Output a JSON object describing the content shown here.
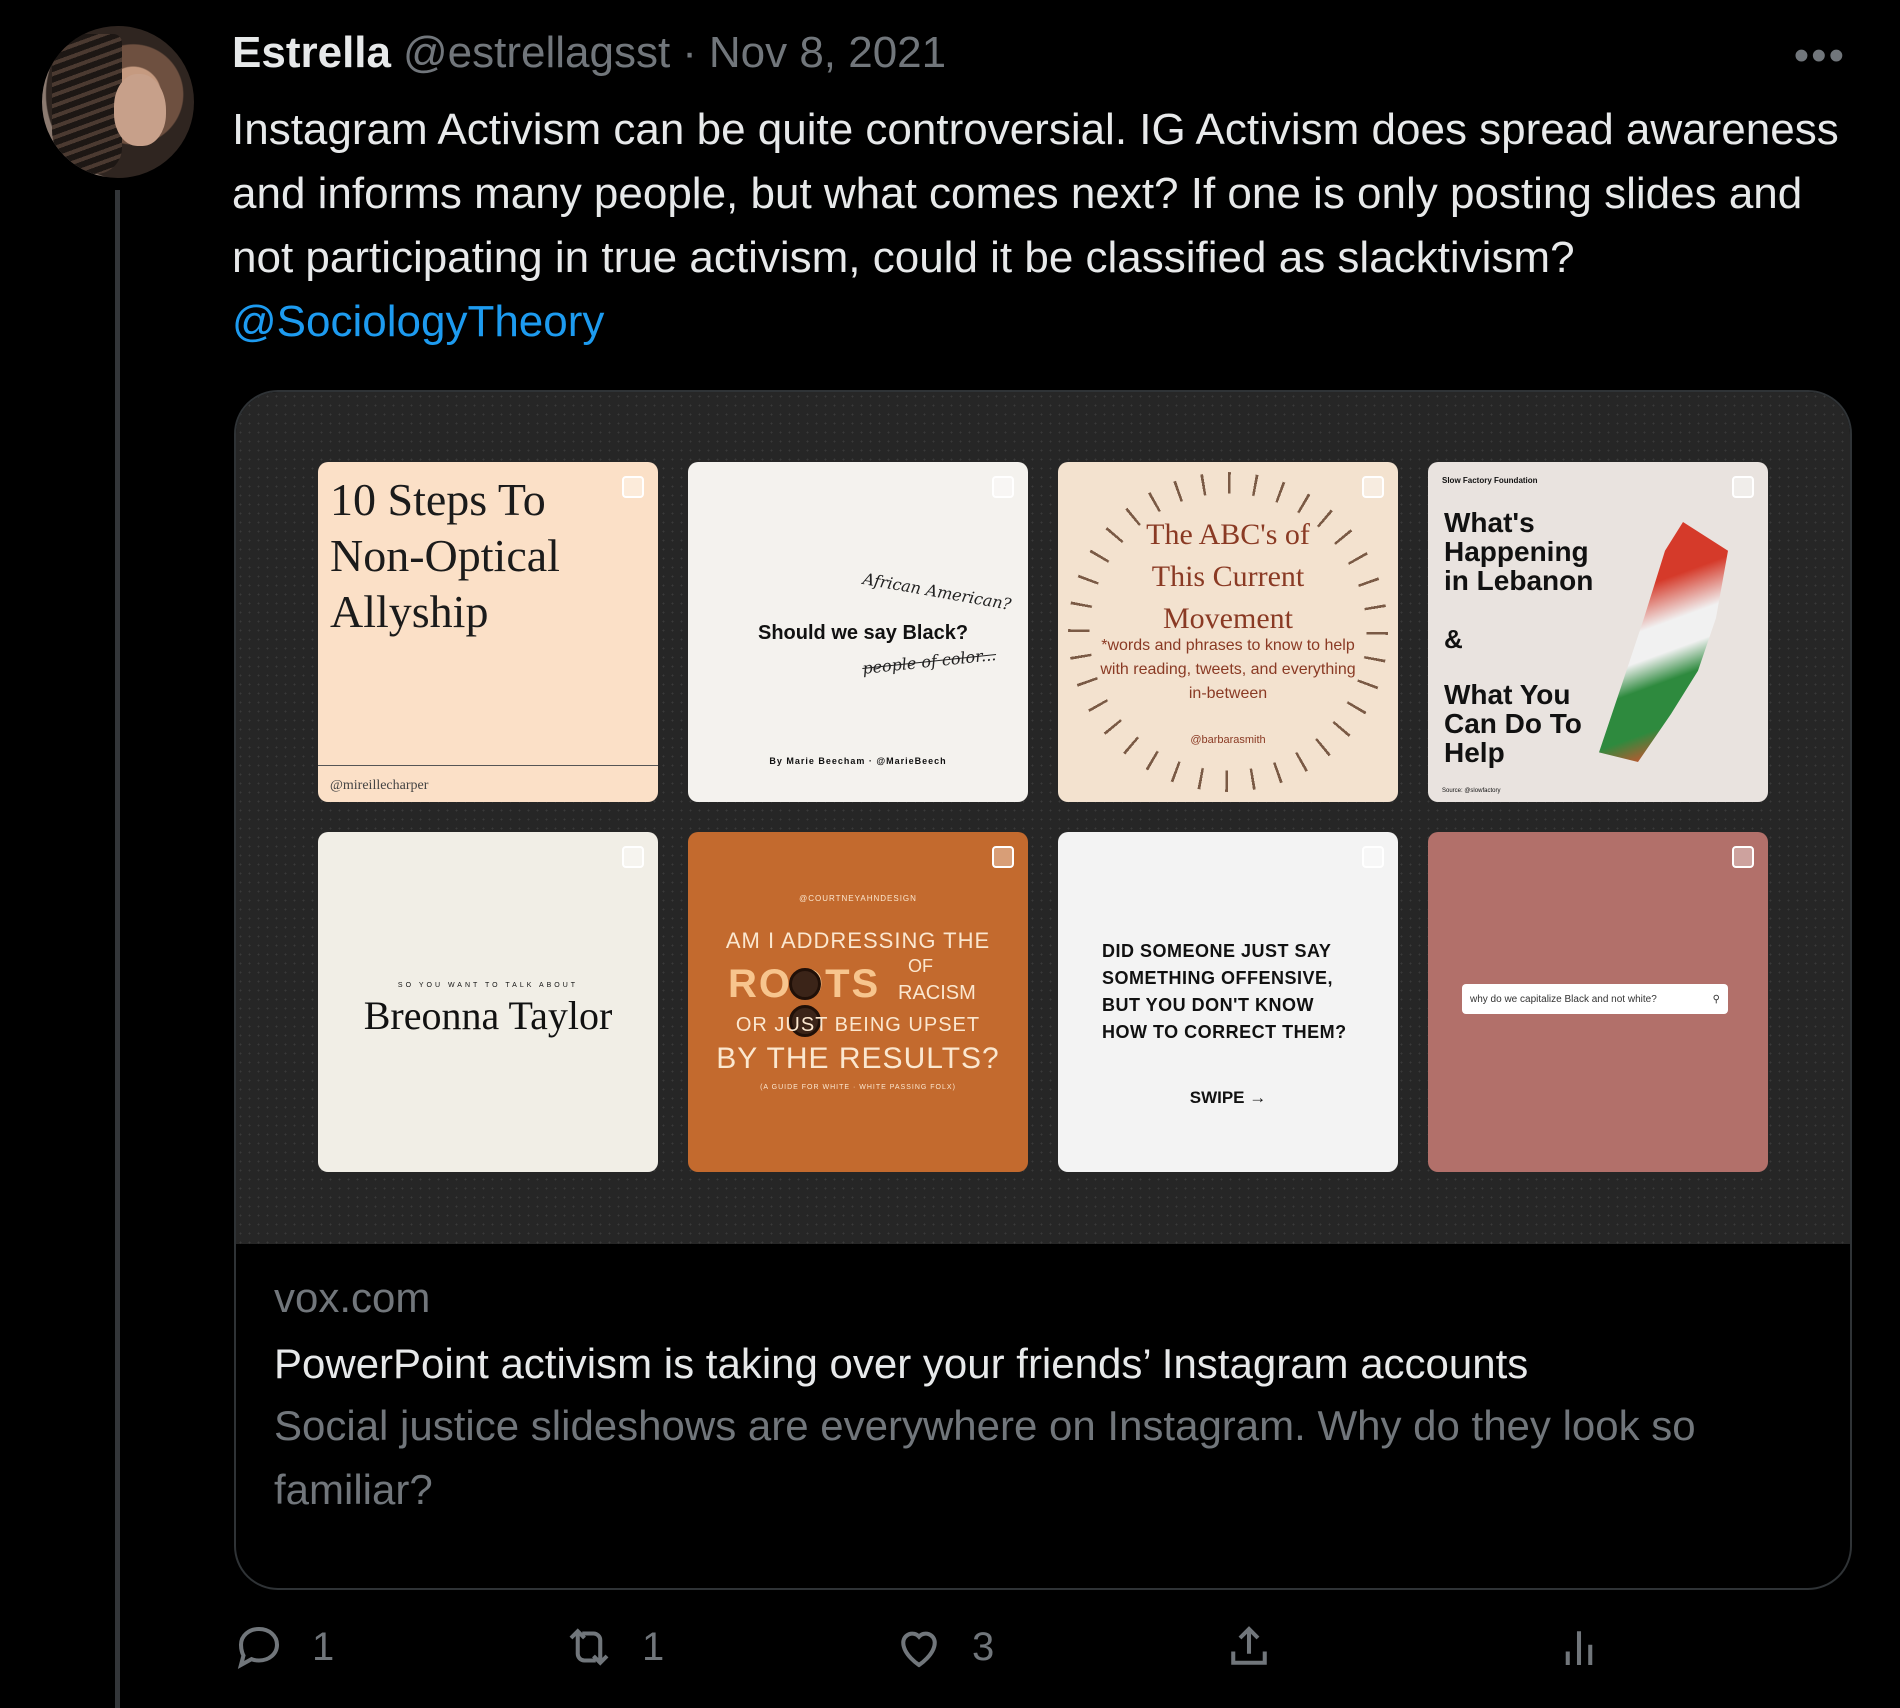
{
  "tweet": {
    "author_name": "Estrella",
    "handle": "@estrellagsst",
    "separator": "·",
    "date": "Nov 8, 2021",
    "more_label": "•••",
    "text": "Instagram Activism can be quite controversial. IG Activism does spread awareness and informs many people, but what comes next? If one is only posting slides and not participating in true activism, could it be classified as slacktivism? ",
    "mention": "@SociologyTheory"
  },
  "card": {
    "tiles": {
      "t1": {
        "title": "10 Steps To Non-Optical Allyship",
        "credit": "@mireillecharper"
      },
      "t2": {
        "hand1": "African American?",
        "main": "Should we say Black?",
        "hand2": "people of color...",
        "byline": "By Marie Beecham · @MarieBeech"
      },
      "t3": {
        "title_line1": "The ABC's of",
        "title_line2": "This Current",
        "title_line3": "Movement",
        "sub": "*words and phrases to know to help with reading, tweets, and everything in-between",
        "credit": "@barbarasmith"
      },
      "t4": {
        "org": "Slow Factory Foundation",
        "title": "What's Happening in Lebanon",
        "amp": "&",
        "title2": "What You Can Do To Help",
        "src": "Source: @slowfactory"
      },
      "t5": {
        "kicker": "SO YOU WANT TO TALK ABOUT",
        "main": "Breonna Taylor"
      },
      "t6": {
        "tiny": "@COURTNEYAHNDESIGN",
        "l1": "AM I ADDRESSING THE",
        "roots": "ROOTS",
        "of": "OF",
        "racism": "RACISM",
        "l2": "OR JUST BEING UPSET",
        "l3": "BY THE RESULTS?",
        "guide": "(A GUIDE FOR WHITE · WHITE PASSING FOLX)"
      },
      "t7": {
        "question": "DID SOMEONE JUST SAY SOMETHING OFFENSIVE, BUT YOU DON'T KNOW HOW TO CORRECT THEM?",
        "swipe": "SWIPE →"
      },
      "t8": {
        "search": "why do we capitalize Black and not white?",
        "search_icon_glyph": "⚲"
      }
    },
    "domain": "vox.com",
    "headline": "PowerPoint activism is taking over your friends’ Instagram accounts",
    "description": "Social justice slideshows are everywhere on Instagram. Why do they look so familiar?"
  },
  "actions": {
    "reply_count": "1",
    "retweet_count": "1",
    "like_count": "3"
  },
  "colors": {
    "background": "#000000",
    "text_primary": "#e7e9ea",
    "text_secondary": "#71767b",
    "link": "#1d9bf0",
    "border": "#2f3336"
  }
}
